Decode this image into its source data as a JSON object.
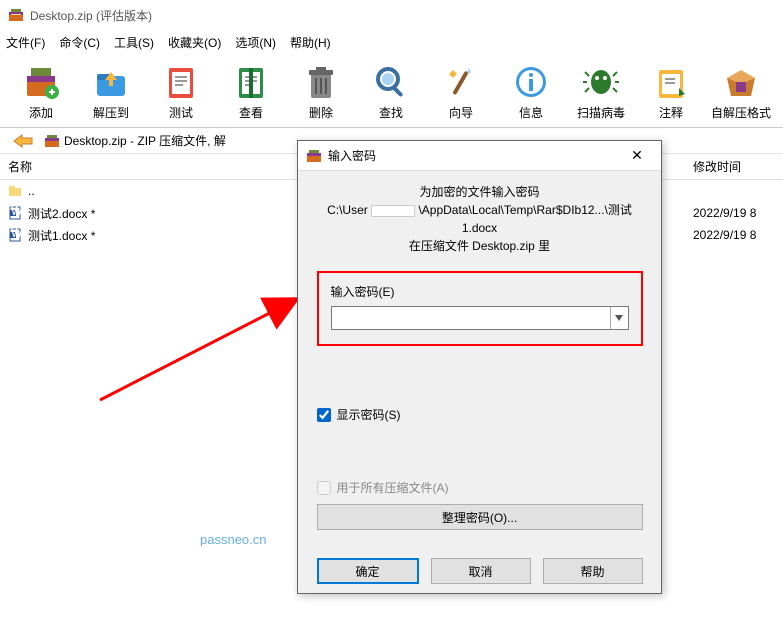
{
  "titlebar": {
    "title": "Desktop.zip (评估版本)"
  },
  "menubar": {
    "file": "文件(F)",
    "cmd": "命令(C)",
    "tool": "工具(S)",
    "fav": "收藏夹(O)",
    "opt": "选项(N)",
    "help": "帮助(H)"
  },
  "toolbar": {
    "items": [
      {
        "label": "添加"
      },
      {
        "label": "解压到"
      },
      {
        "label": "测试"
      },
      {
        "label": "查看"
      },
      {
        "label": "删除"
      },
      {
        "label": "查找"
      },
      {
        "label": "向导"
      },
      {
        "label": "信息"
      },
      {
        "label": "扫描病毒"
      },
      {
        "label": "注释"
      },
      {
        "label": "自解压格式"
      }
    ]
  },
  "crumb": {
    "path": "Desktop.zip - ZIP 压缩文件, 解"
  },
  "filelist": {
    "headers": {
      "name": "名称",
      "date": "修改时间"
    },
    "rows": [
      {
        "name": "..",
        "date": "",
        "kind": "up"
      },
      {
        "name": "测试2.docx *",
        "date": "2022/9/19 8",
        "kind": "doc"
      },
      {
        "name": "测试1.docx *",
        "date": "2022/9/19 8",
        "kind": "doc"
      }
    ]
  },
  "dialog": {
    "title": "输入密码",
    "line1": "为加密的文件输入密码",
    "line2a": "C:\\User",
    "line2b": "\\AppData\\Local\\Temp\\Rar$DIb12...\\测试1.docx",
    "line3": "在压缩文件 Desktop.zip 里",
    "pwLabel": "输入密码(E)",
    "pwValue": "",
    "show": "显示密码(S)",
    "useAll": "用于所有压缩文件(A)",
    "organize": "整理密码(O)...",
    "ok": "确定",
    "cancel": "取消",
    "help": "帮助"
  },
  "watermark": "passneo.cn"
}
